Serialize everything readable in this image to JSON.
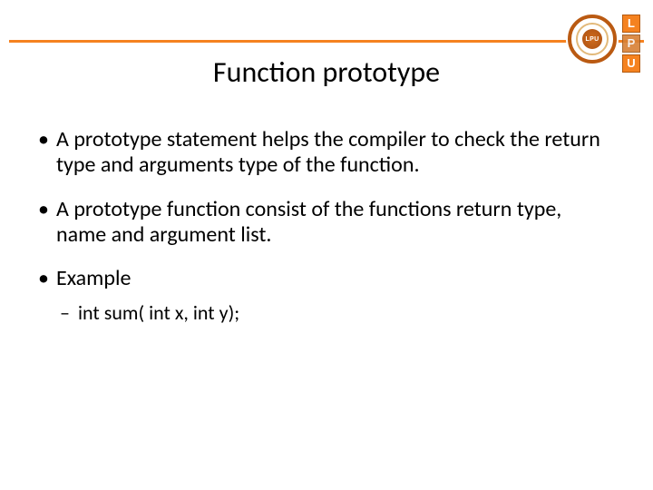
{
  "title": "Function prototype",
  "bullets": [
    "A prototype statement helps the compiler to check the return type and arguments type of the function.",
    "A prototype function consist of the functions return type, name and argument list.",
    "Example"
  ],
  "sub_example": "int sum( int  x, int  y);",
  "logo": {
    "letters": [
      "L",
      "P",
      "U"
    ],
    "seal_text": "LPU"
  }
}
